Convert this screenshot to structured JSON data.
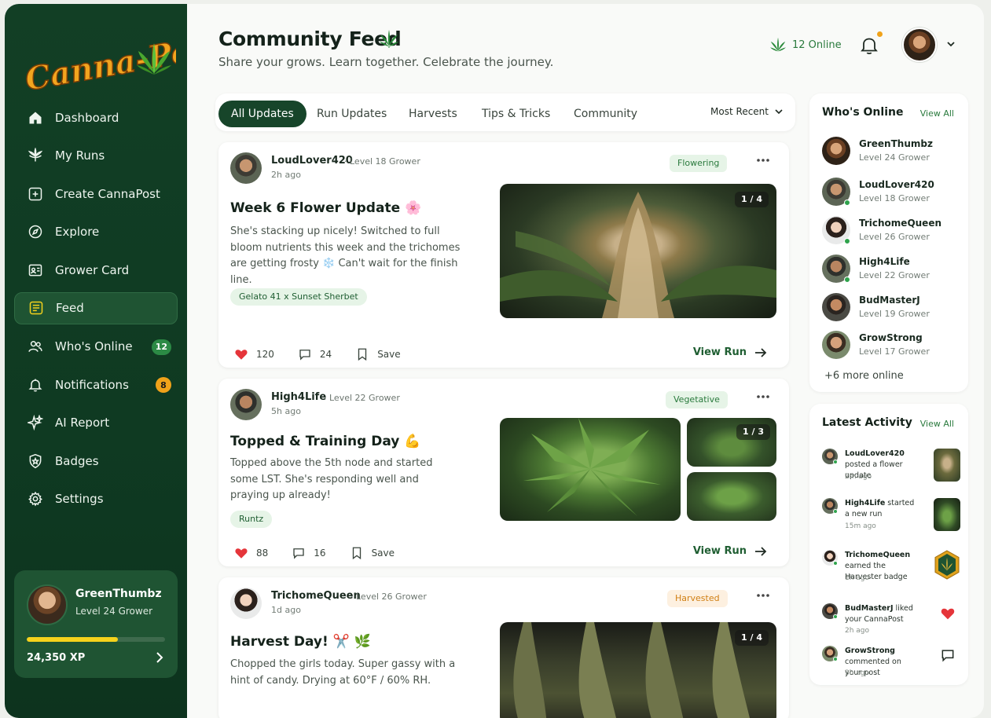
{
  "brand": {
    "logo_text": "Canna-Post"
  },
  "sidebar": {
    "items": [
      {
        "label": "Dashboard",
        "icon": "home-icon"
      },
      {
        "label": "My Runs",
        "icon": "leaf-icon"
      },
      {
        "label": "Create CannaPost",
        "icon": "plus-square-icon"
      },
      {
        "label": "Explore",
        "icon": "compass-icon"
      },
      {
        "label": "Grower Card",
        "icon": "id-card-icon"
      },
      {
        "label": "Feed",
        "icon": "feed-list-icon",
        "active": true
      },
      {
        "label": "Who's Online",
        "icon": "users-icon",
        "badge": "12"
      },
      {
        "label": "Notifications",
        "icon": "bell-icon",
        "badge": "8"
      },
      {
        "label": "AI Report",
        "icon": "sparkle-icon"
      },
      {
        "label": "Badges",
        "icon": "shield-icon"
      },
      {
        "label": "Settings",
        "icon": "gear-icon"
      }
    ],
    "profile": {
      "name": "GreenThumbz",
      "level": "Level 24 Grower",
      "xp": "24,350 XP",
      "xp_progress": 0.66
    }
  },
  "header": {
    "title": "Community Feed",
    "subtitle": "Share your grows. Learn together. Celebrate the journey.",
    "online": "12 Online"
  },
  "tabs": [
    "All Updates",
    "Run Updates",
    "Harvests",
    "Tips & Tricks",
    "Community"
  ],
  "sort": "Most Recent",
  "posts": [
    {
      "user": "LoudLover420",
      "level": "Level 18 Grower",
      "time": "2h ago",
      "stage": "Flowering",
      "title": "Week 6 Flower Update 🌸",
      "body": "She's stacking up nicely! Switched to full bloom nutrients this week and the trichomes are getting frosty ❄️ Can't wait for the finish line.",
      "tag": "Gelato 41 x Sunset Sherbet",
      "likes": "120",
      "comments": "24",
      "save": "Save",
      "view": "View Run",
      "counter": "1 / 4"
    },
    {
      "user": "High4Life",
      "level": "Level 22 Grower",
      "time": "5h ago",
      "stage": "Vegetative",
      "title": "Topped & Training Day 💪",
      "body": "Topped above the 5th node and started some LST. She's responding well and praying up already!",
      "tag": "Runtz",
      "likes": "88",
      "comments": "16",
      "save": "Save",
      "view": "View Run",
      "counter": "1 / 3"
    },
    {
      "user": "TrichomeQueen",
      "level": "Level 26 Grower",
      "time": "1d ago",
      "stage": "Harvested",
      "title": "Harvest Day! ✂️ 🌿",
      "body": "Chopped the girls today. Super gassy with a hint of candy. Drying at 60°F / 60% RH.",
      "counter": "1 / 4"
    }
  ],
  "whos_online": {
    "title": "Who's Online",
    "view_all": "View All",
    "users": [
      {
        "name": "GreenThumbz",
        "level": "Level 24 Grower"
      },
      {
        "name": "LoudLover420",
        "level": "Level 18 Grower"
      },
      {
        "name": "TrichomeQueen",
        "level": "Level 26 Grower"
      },
      {
        "name": "High4Life",
        "level": "Level 22 Grower"
      },
      {
        "name": "BudMasterJ",
        "level": "Level 19 Grower"
      },
      {
        "name": "GrowStrong",
        "level": "Level 17 Grower"
      }
    ],
    "more": "+6 more online"
  },
  "activity": {
    "title": "Latest Activity",
    "view_all": "View All",
    "items": [
      {
        "user": "LoudLover420",
        "text": " posted a flower update",
        "time": "2m ago"
      },
      {
        "user": "High4Life",
        "text": " started a new run",
        "time": "15m ago"
      },
      {
        "user": "TrichomeQueen",
        "text": " earned the Harvester badge",
        "time": "1h ago"
      },
      {
        "user": "BudMasterJ",
        "text": " liked your CannaPost",
        "time": "2h ago"
      },
      {
        "user": "GrowStrong",
        "text": " commented on your post",
        "time": "3h ago"
      }
    ]
  },
  "colors": {
    "sidebar": "#123f25",
    "accent": "#2a7a3d",
    "like": "#e5353a",
    "badge_orange": "#f0a21a",
    "xp": "#f6d21c"
  }
}
